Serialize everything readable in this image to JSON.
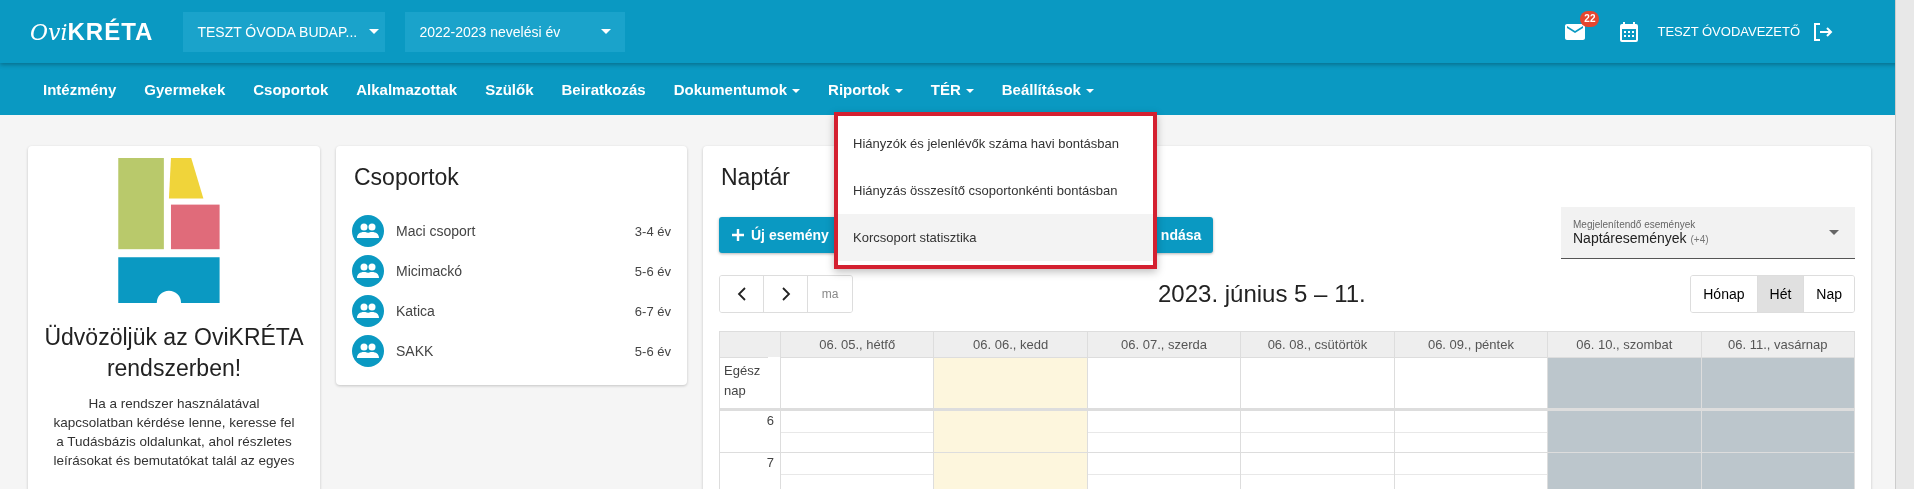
{
  "header": {
    "logo": {
      "prefix": "Ovi",
      "name": "KRÉTA"
    },
    "institution": "TESZT ÓVODA BUDAP...",
    "year": "2022-2023 nevelési év",
    "mail_badge": "22",
    "user": "TESZT ÓVODAVEZETŐ"
  },
  "nav": [
    {
      "label": "Intézmény",
      "has_menu": false
    },
    {
      "label": "Gyermekek",
      "has_menu": false
    },
    {
      "label": "Csoportok",
      "has_menu": false
    },
    {
      "label": "Alkalmazottak",
      "has_menu": false
    },
    {
      "label": "Szülők",
      "has_menu": false
    },
    {
      "label": "Beiratkozás",
      "has_menu": false
    },
    {
      "label": "Dokumentumok",
      "has_menu": true
    },
    {
      "label": "Riportok",
      "has_menu": true
    },
    {
      "label": "TÉR",
      "has_menu": true
    },
    {
      "label": "Beállítások",
      "has_menu": true
    }
  ],
  "dropdown": [
    {
      "label": "Hiányzók és jelenlévők száma havi bontásban",
      "highlighted": false
    },
    {
      "label": "Hiányzás összesítő csoportonkénti bontásban",
      "highlighted": false
    },
    {
      "label": "Korcsoport statisztika",
      "highlighted": true
    }
  ],
  "welcome": {
    "title": "Üdvözöljük az OviKRÉTA rendszerben!",
    "text": "Ha a rendszer használatával kapcsolatban kérdése lenne, keresse fel a Tudásbázis oldalunkat, ahol részletes leírásokat és bemutatókat talál az egyes"
  },
  "groups": {
    "title": "Csoportok",
    "items": [
      {
        "name": "Maci csoport",
        "age": "3-4 év"
      },
      {
        "name": "Micimackó",
        "age": "5-6 év"
      },
      {
        "name": "Katica",
        "age": "6-7 év"
      },
      {
        "name": "SAKK",
        "age": "5-6 év"
      }
    ]
  },
  "calendar": {
    "title": "Naptár",
    "new_event": "Új esemény",
    "second_button": "ndása",
    "filter": {
      "label": "Megjelenítendő események",
      "value": "Naptáresemények",
      "extra": "(+4)"
    },
    "today": "ma",
    "range": "2023. június 5 – 11.",
    "views": [
      {
        "label": "Hónap",
        "selected": false
      },
      {
        "label": "Hét",
        "selected": true
      },
      {
        "label": "Nap",
        "selected": false
      }
    ],
    "days": [
      {
        "label": "06. 05., hétfő",
        "kind": "weekday"
      },
      {
        "label": "06. 06., kedd",
        "kind": "today"
      },
      {
        "label": "06. 07., szerda",
        "kind": "weekday"
      },
      {
        "label": "06. 08., csütörtök",
        "kind": "weekday"
      },
      {
        "label": "06. 09., péntek",
        "kind": "weekday"
      },
      {
        "label": "06. 10., szombat",
        "kind": "weekend"
      },
      {
        "label": "06. 11., vasárnap",
        "kind": "weekend"
      }
    ],
    "all_day": "Egész nap",
    "hours": [
      "6",
      "7"
    ]
  }
}
